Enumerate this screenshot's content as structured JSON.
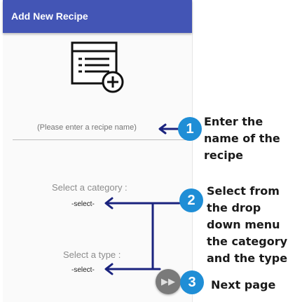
{
  "app_bar": {
    "title": "Add New Recipe"
  },
  "recipe_icon": {
    "icon": "recipe-list-add-icon"
  },
  "recipe_name": {
    "value": "",
    "placeholder": "(Please enter a recipe name)"
  },
  "category": {
    "label": "Select a category :",
    "selected": "-select-"
  },
  "type": {
    "label": "Select a type :",
    "selected": "-select-"
  },
  "next_button": {
    "icon": "fast-forward-icon"
  },
  "callouts": [
    {
      "number": "1",
      "text": "Enter the name of the recipe"
    },
    {
      "number": "2",
      "text": "Select from the drop down menu the category and the type"
    },
    {
      "number": "3",
      "text": "Next page"
    }
  ],
  "colors": {
    "app_bar": "#4355b5",
    "badge": "#1f8ed6",
    "arrow": "#1a237e",
    "next_button": "#7a7a7a"
  }
}
